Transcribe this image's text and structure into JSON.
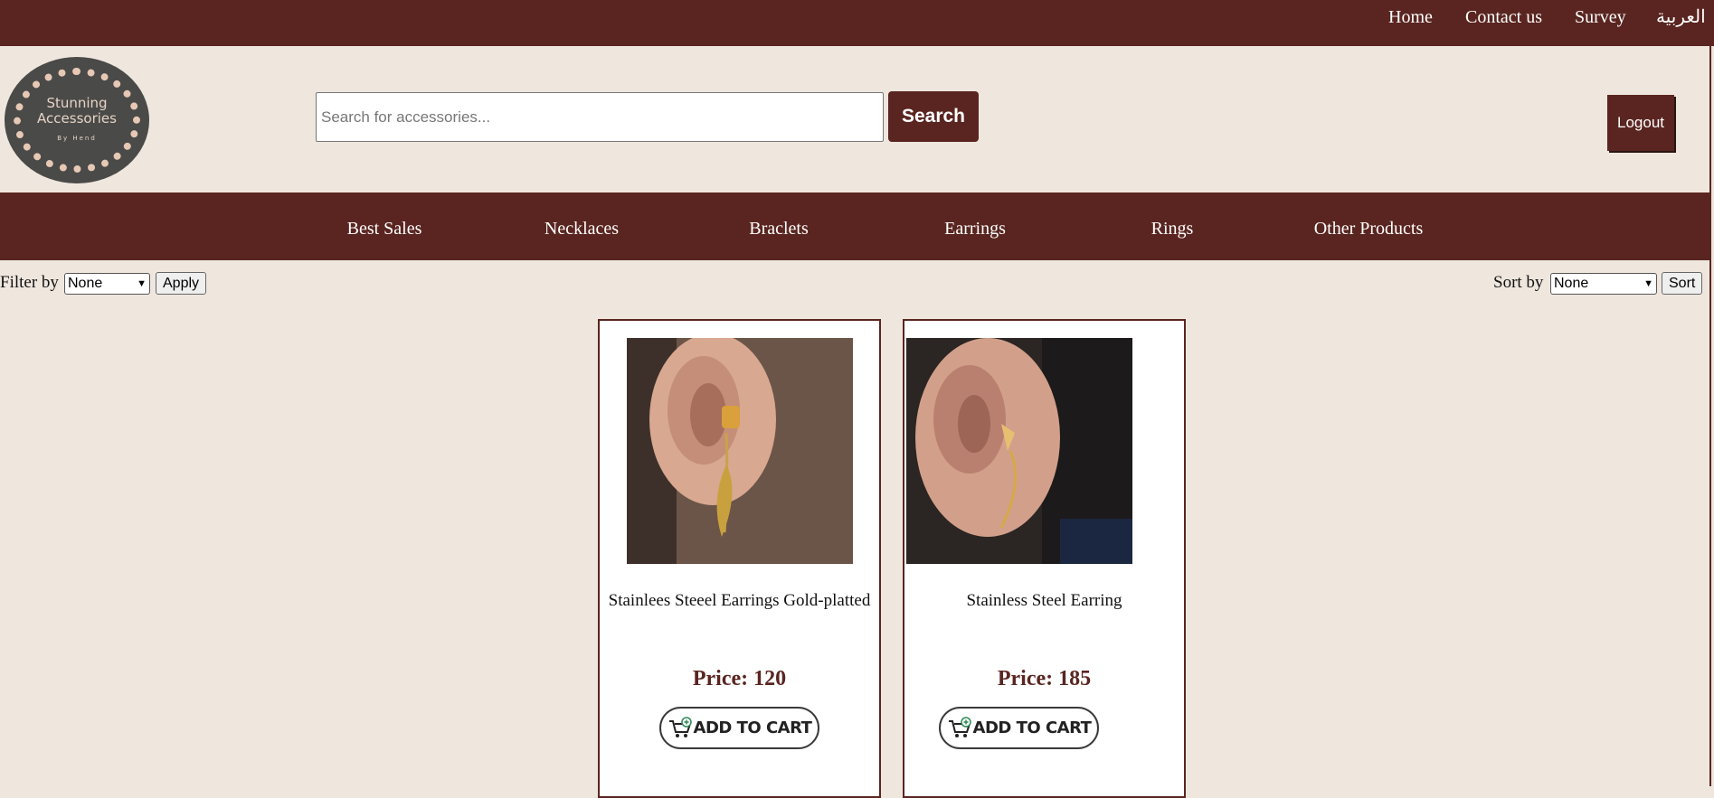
{
  "top_nav": {
    "home": "Home",
    "contact": "Contact us",
    "survey": "Survey",
    "language": "العربية"
  },
  "logo": {
    "line1": "Stunning",
    "line2": "Accessories",
    "line3": "By Hend"
  },
  "search": {
    "placeholder": "Search for accessories...",
    "button": "Search"
  },
  "logout": "Logout",
  "categories": [
    "Best Sales",
    "Necklaces",
    "Braclets",
    "Earrings",
    "Rings",
    "Other Products"
  ],
  "filter": {
    "label": "Filter by",
    "selected": "None",
    "button": "Apply"
  },
  "sort": {
    "label": "Sort by",
    "selected": "None",
    "button": "Sort"
  },
  "products": [
    {
      "name": "Stainlees Steeel Earrings Gold-platted",
      "price": "Price: 120",
      "cart": "ADD TO CART"
    },
    {
      "name": "Stainless Steel Earring",
      "price": "Price: 185",
      "cart": "ADD TO CART"
    }
  ],
  "colors": {
    "brand": "#5a2520",
    "background": "#efe7de",
    "card_border": "#5a2520"
  }
}
